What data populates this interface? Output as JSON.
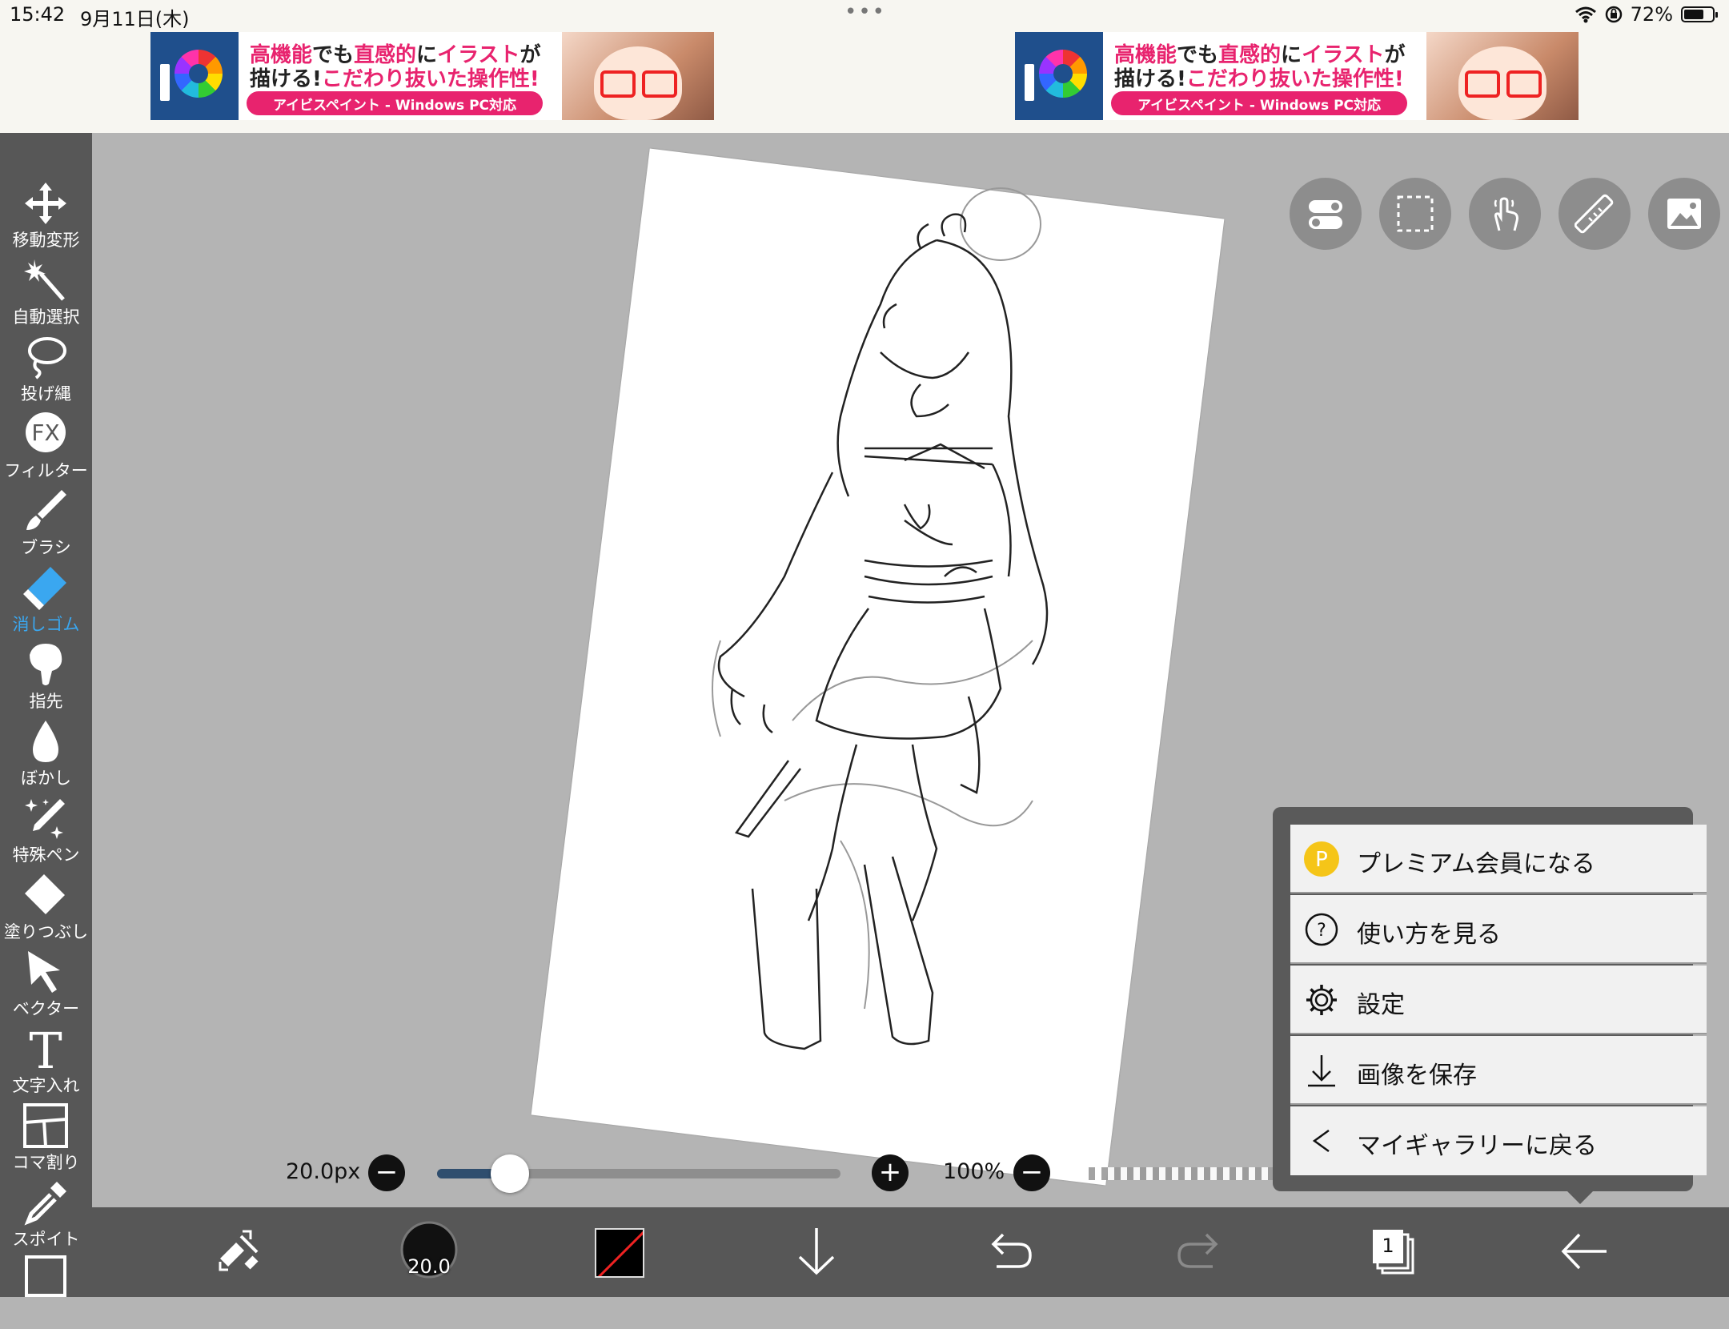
{
  "status": {
    "time": "15:42",
    "date": "9月11日(木)",
    "dots": "•••",
    "battery_text": "72%",
    "battery_level": 0.72
  },
  "ads": [
    {
      "line1_a": "高機能",
      "line1_b": "でも",
      "line1_c": "直感的",
      "line1_d": "に",
      "line1_e": "イラスト",
      "line1_f": "が",
      "line2_a": "描ける!",
      "line2_b": "こだわり抜いた",
      "line2_c": "操作性!",
      "pill": "アイビスペイント - Windows PC対応"
    },
    {
      "line1_a": "高機能",
      "line1_b": "でも",
      "line1_c": "直感的",
      "line1_d": "に",
      "line1_e": "イラスト",
      "line1_f": "が",
      "line2_a": "描ける!",
      "line2_b": "こだわり抜いた",
      "line2_c": "操作性!",
      "pill": "アイビスペイント - Windows PC対応"
    }
  ],
  "tools": [
    {
      "label": "移動変形",
      "icon": "move-transform-icon"
    },
    {
      "label": "自動選択",
      "icon": "magic-wand-icon"
    },
    {
      "label": "投げ縄",
      "icon": "lasso-icon"
    },
    {
      "label": "フィルター",
      "icon": "filter-fx-icon"
    },
    {
      "label": "ブラシ",
      "icon": "brush-icon"
    },
    {
      "label": "消しゴム",
      "icon": "eraser-icon"
    },
    {
      "label": "指先",
      "icon": "finger-smudge-icon"
    },
    {
      "label": "ぼかし",
      "icon": "blur-drop-icon"
    },
    {
      "label": "特殊ペン",
      "icon": "special-pen-icon"
    },
    {
      "label": "塗りつぶし",
      "icon": "fill-bucket-icon"
    },
    {
      "label": "ベクター",
      "icon": "vector-arrow-icon"
    },
    {
      "label": "文字入れ",
      "icon": "text-icon"
    },
    {
      "label": "コマ割り",
      "icon": "panel-divide-icon"
    },
    {
      "label": "スポイト",
      "icon": "eyedropper-icon"
    }
  ],
  "active_tool": "消しゴム",
  "brush": {
    "size_text": "20.0px",
    "size_fraction": 0.18,
    "opacity_text": "100%",
    "minus": "−",
    "plus": "+",
    "badge": "20.0"
  },
  "bottom_bar": {
    "layer_count": "1"
  },
  "menu": {
    "items": [
      {
        "label": "プレミアム会員になる",
        "icon": "premium-p-icon",
        "icon_text": "P"
      },
      {
        "label": "使い方を見る",
        "icon": "help-icon",
        "icon_text": "?"
      },
      {
        "label": "設定",
        "icon": "gear-icon"
      },
      {
        "label": "画像を保存",
        "icon": "save-download-icon"
      },
      {
        "label": "マイギャラリーに戻る",
        "icon": "back-chevron-icon"
      }
    ]
  },
  "colors": {
    "accent": "#3aa7f0",
    "toolbar": "#575757",
    "premium": "#f5c518"
  }
}
